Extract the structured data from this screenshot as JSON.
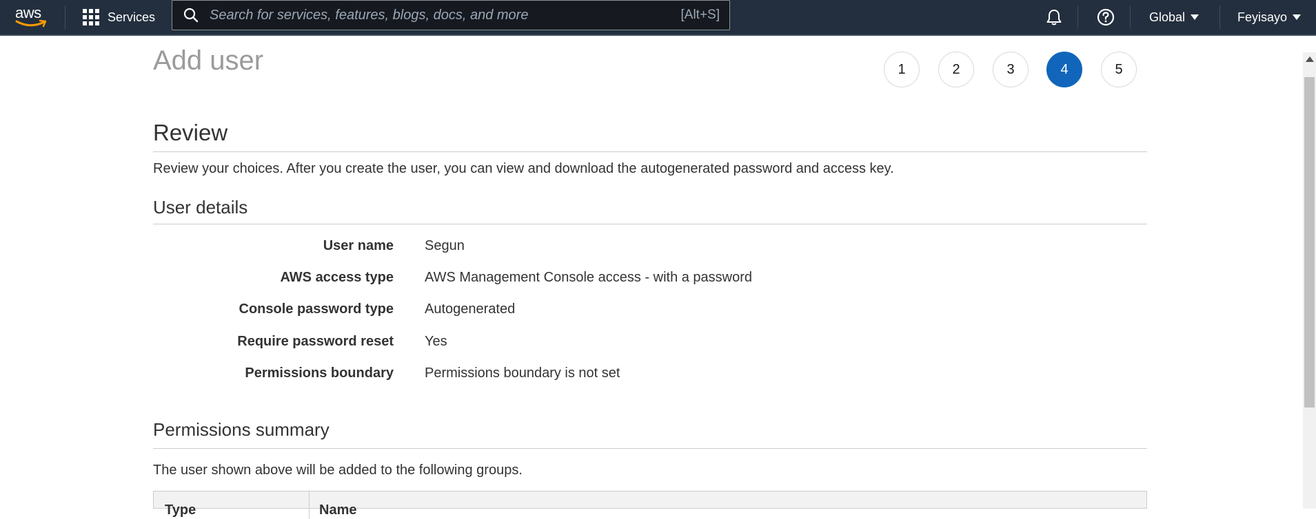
{
  "nav": {
    "logo_text": "aws",
    "services_label": "Services",
    "search_placeholder": "Search for services, features, blogs, docs, and more",
    "search_shortcut": "[Alt+S]",
    "region_label": "Global",
    "user_label": "Feyisayo",
    "icons": [
      "grid-icon",
      "search-icon",
      "bell-icon",
      "help-icon",
      "caret-down-icon"
    ]
  },
  "wizard": {
    "title": "Add user",
    "steps": [
      "1",
      "2",
      "3",
      "4",
      "5"
    ],
    "active_step": "4"
  },
  "review": {
    "title": "Review",
    "description": "Review your choices. After you create the user, you can view and download the autogenerated password and access key."
  },
  "user_details": {
    "title": "User details",
    "rows": [
      {
        "label": "User name",
        "value": "Segun"
      },
      {
        "label": "AWS access type",
        "value": "AWS Management Console access - with a password"
      },
      {
        "label": "Console password type",
        "value": "Autogenerated"
      },
      {
        "label": "Require password reset",
        "value": "Yes"
      },
      {
        "label": "Permissions boundary",
        "value": "Permissions boundary is not set"
      }
    ]
  },
  "permissions_summary": {
    "title": "Permissions summary",
    "description": "The user shown above will be added to the following groups.",
    "columns": [
      "Type",
      "Name"
    ]
  },
  "colors": {
    "nav_bg": "#232f3e",
    "active_step": "#1166bb",
    "aws_smile": "#ff9900"
  }
}
